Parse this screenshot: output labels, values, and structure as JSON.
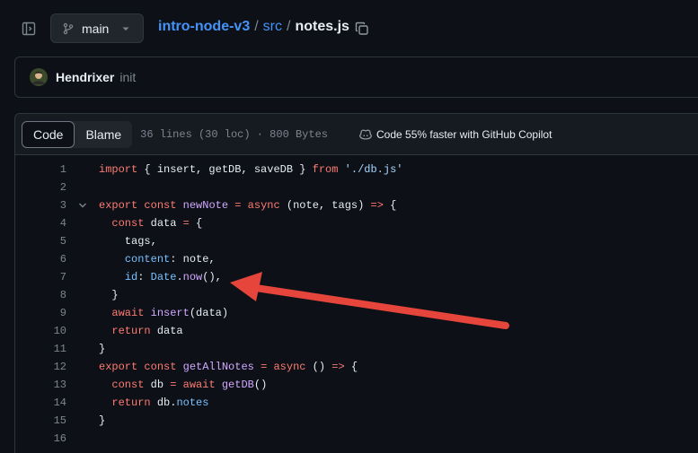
{
  "topbar": {
    "branch": "main",
    "repo": "intro-node-v3",
    "folder": "src",
    "file": "notes.js",
    "sep1": "/",
    "sep2": "/"
  },
  "commit": {
    "author": "Hendrixer",
    "message": "init"
  },
  "file_header": {
    "tabs": [
      "Code",
      "Blame"
    ],
    "active_tab": "Code",
    "meta": "36 lines (30 loc) · 800 Bytes",
    "copilot": "Code 55% faster with GitHub Copilot"
  },
  "code": {
    "lines": [
      {
        "n": "1",
        "tokens": [
          [
            "k",
            "import"
          ],
          [
            "p",
            " { insert, getDB, saveDB } "
          ],
          [
            "k",
            "from"
          ],
          [
            "p",
            " "
          ],
          [
            "s",
            "'./db.js'"
          ]
        ]
      },
      {
        "n": "2",
        "tokens": []
      },
      {
        "n": "3",
        "fold": true,
        "tokens": [
          [
            "k",
            "export"
          ],
          [
            "p",
            " "
          ],
          [
            "k",
            "const"
          ],
          [
            "p",
            " "
          ],
          [
            "f",
            "newNote"
          ],
          [
            "p",
            " "
          ],
          [
            "k",
            "="
          ],
          [
            "p",
            " "
          ],
          [
            "k",
            "async"
          ],
          [
            "p",
            " (note, tags) "
          ],
          [
            "k",
            "=>"
          ],
          [
            "p",
            " {"
          ]
        ]
      },
      {
        "n": "4",
        "tokens": [
          [
            "p",
            "  "
          ],
          [
            "k",
            "const"
          ],
          [
            "p",
            " data "
          ],
          [
            "k",
            "="
          ],
          [
            "p",
            " {"
          ]
        ]
      },
      {
        "n": "5",
        "tokens": [
          [
            "p",
            "    tags,"
          ]
        ]
      },
      {
        "n": "6",
        "tokens": [
          [
            "p",
            "    "
          ],
          [
            "c",
            "content"
          ],
          [
            "p",
            ": note,"
          ]
        ]
      },
      {
        "n": "7",
        "tokens": [
          [
            "p",
            "    "
          ],
          [
            "c",
            "id"
          ],
          [
            "p",
            ": "
          ],
          [
            "c",
            "Date"
          ],
          [
            "p",
            "."
          ],
          [
            "f",
            "now"
          ],
          [
            "p",
            "(),"
          ]
        ]
      },
      {
        "n": "8",
        "tokens": [
          [
            "p",
            "  }"
          ]
        ]
      },
      {
        "n": "9",
        "tokens": [
          [
            "p",
            "  "
          ],
          [
            "k",
            "await"
          ],
          [
            "p",
            " "
          ],
          [
            "f",
            "insert"
          ],
          [
            "p",
            "(data)"
          ]
        ]
      },
      {
        "n": "10",
        "tokens": [
          [
            "p",
            "  "
          ],
          [
            "k",
            "return"
          ],
          [
            "p",
            " data"
          ]
        ]
      },
      {
        "n": "11",
        "tokens": [
          [
            "p",
            "}"
          ]
        ]
      },
      {
        "n": "12",
        "tokens": [
          [
            "k",
            "export"
          ],
          [
            "p",
            " "
          ],
          [
            "k",
            "const"
          ],
          [
            "p",
            " "
          ],
          [
            "f",
            "getAllNotes"
          ],
          [
            "p",
            " "
          ],
          [
            "k",
            "="
          ],
          [
            "p",
            " "
          ],
          [
            "k",
            "async"
          ],
          [
            "p",
            " () "
          ],
          [
            "k",
            "=>"
          ],
          [
            "p",
            " {"
          ]
        ]
      },
      {
        "n": "13",
        "tokens": [
          [
            "p",
            "  "
          ],
          [
            "k",
            "const"
          ],
          [
            "p",
            " db "
          ],
          [
            "k",
            "="
          ],
          [
            "p",
            " "
          ],
          [
            "k",
            "await"
          ],
          [
            "p",
            " "
          ],
          [
            "f",
            "getDB"
          ],
          [
            "p",
            "()"
          ]
        ]
      },
      {
        "n": "14",
        "tokens": [
          [
            "p",
            "  "
          ],
          [
            "k",
            "return"
          ],
          [
            "p",
            " db."
          ],
          [
            "c",
            "notes"
          ]
        ]
      },
      {
        "n": "15",
        "tokens": [
          [
            "p",
            "}"
          ]
        ]
      },
      {
        "n": "16",
        "tokens": []
      }
    ]
  },
  "colors": {
    "accent_link": "#4493f8",
    "annotation_arrow": "#e5453b"
  },
  "icons": [
    "sidebar-toggle-icon",
    "git-branch-icon",
    "chevron-down-icon",
    "copy-icon",
    "copilot-icon",
    "fold-chevron-icon"
  ]
}
